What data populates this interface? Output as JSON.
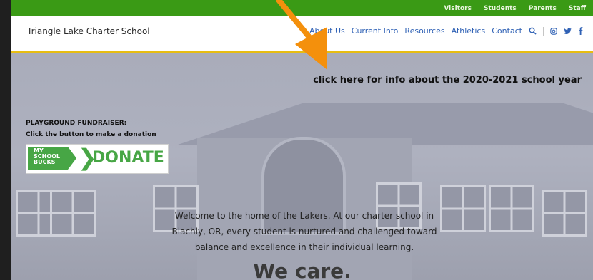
{
  "topbar": {
    "links": [
      "Visitors",
      "Students",
      "Parents",
      "Staff"
    ]
  },
  "header": {
    "title": "Triangle Lake Charter School",
    "nav": [
      "About Us",
      "Current Info",
      "Resources",
      "Athletics",
      "Contact"
    ],
    "icons": [
      "search-icon",
      "instagram-icon",
      "twitter-icon",
      "facebook-icon"
    ]
  },
  "hero": {
    "info_link": "click here for info about the 2020-2021 school year",
    "fundraiser_title": "PLAYGROUND FUNDRAISER:",
    "fundraiser_sub": "Click the button to make a donation",
    "donate_brand": [
      "MY",
      "SCHOOL",
      "BUCKS"
    ],
    "donate_label": "DONATE",
    "welcome_lines": [
      "Welcome to the home of the Lakers. At our charter school in",
      "Blachly, OR, every student is nurtured and challenged toward",
      "balance and excellence in their individual learning."
    ],
    "tagline": "We care."
  },
  "colors": {
    "topbar": "#3a9a15",
    "nav": "#2f61b5",
    "accent": "#e7bd12",
    "arrow": "#f4900c",
    "donate": "#47a645"
  }
}
